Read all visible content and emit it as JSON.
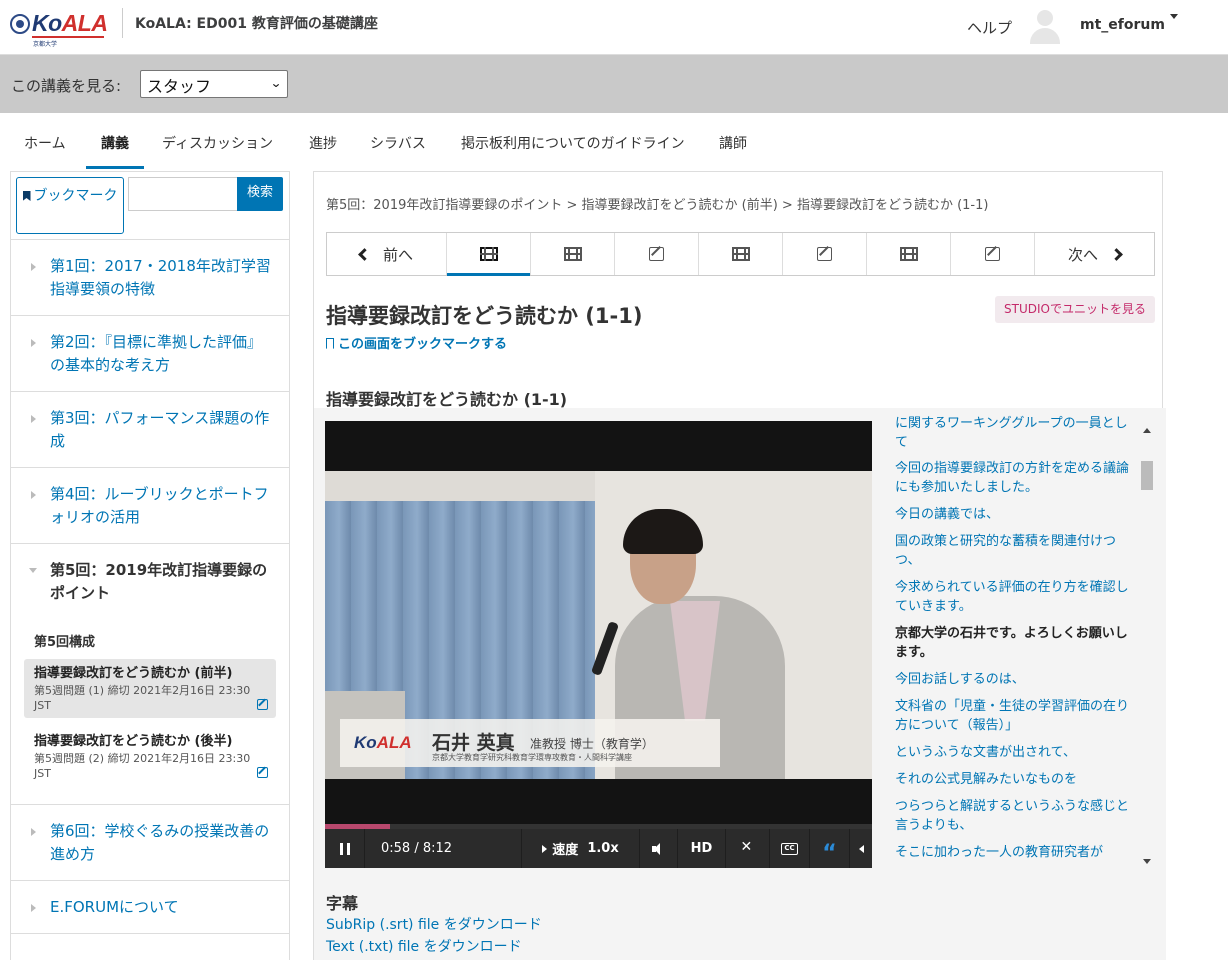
{
  "header": {
    "logo_text_ko": "Ko",
    "logo_text_ala": "ALA",
    "logo_sub": "京都大学",
    "course_title": "KoALA: ED001 教育評価の基礎講座",
    "help": "ヘルプ",
    "username": "mt_eforum"
  },
  "viewbar": {
    "label": "この講義を見る:",
    "selected": "スタッフ"
  },
  "tabs": [
    {
      "label": "ホーム"
    },
    {
      "label": "講義"
    },
    {
      "label": "ディスカッション"
    },
    {
      "label": "進捗"
    },
    {
      "label": "シラバス"
    },
    {
      "label": "掲示板利用についてのガイドライン"
    },
    {
      "label": "講師"
    }
  ],
  "sidebar": {
    "bookmark_button": "ブックマーク",
    "search_button": "検索",
    "sections": [
      {
        "label": "第1回：2017・2018年改訂学習指導要領の特徴"
      },
      {
        "label": "第2回：『目標に準拠した評価』の基本的な考え方"
      },
      {
        "label": "第3回：パフォーマンス課題の作成"
      },
      {
        "label": "第4回：ルーブリックとポートフォリオの活用"
      },
      {
        "label": "第5回：2019年改訂指導要録のポイント"
      },
      {
        "label": "第6回：学校ぐるみの授業改善の進め方"
      },
      {
        "label": "E.FORUMについて"
      }
    ],
    "composition_label": "第5回構成",
    "subsections": [
      {
        "title": "指導要録改訂をどう読むか (前半)",
        "due": "第5週問題 (1) 締切 2021年2月16日 23:30 JST"
      },
      {
        "title": "指導要録改訂をどう読むか (後半)",
        "due": "第5週問題 (2) 締切 2021年2月16日 23:30 JST"
      }
    ]
  },
  "main": {
    "breadcrumb": "第5回：2019年改訂指導要録のポイント > 指導要録改訂をどう読むか (前半) > 指導要録改訂をどう読むか (1-1)",
    "prev": "前へ",
    "next": "次へ",
    "unit_title": "指導要録改訂をどう読むか (1-1)",
    "studio_button": "STUDIOでユニットを見る",
    "bookmark_link": "この画面をブックマークする",
    "video_heading": "指導要録改訂をどう読むか (1-1)",
    "captions_title": "字幕",
    "download_srt": "SubRip (.srt) file をダウンロード",
    "download_txt": "Text (.txt) file をダウンロード"
  },
  "video": {
    "time": "0:58 / 8:12",
    "speed_label": "速度",
    "speed_value": "1.0x",
    "hd": "HD",
    "cc": "CC",
    "progress": 0.118,
    "overlay_logo_ko": "Ko",
    "overlay_logo_ala": "ALA",
    "overlay_name": "石井 英真",
    "overlay_title": "准教授 博士（教育学）",
    "overlay_affiliation": "京都大学教育学研究科教育学環専攻教育・人間科学講座"
  },
  "transcript": [
    {
      "text": "に関するワーキンググループの一員として"
    },
    {
      "text": "今回の指導要録改訂の方針を定める議論にも参加いたしました。"
    },
    {
      "text": "今日の講義では、"
    },
    {
      "text": "国の政策と研究的な蓄積を関連付けつつ、"
    },
    {
      "text": "今求められている評価の在り方を確認していきます。"
    },
    {
      "text": "京都大学の石井です。よろしくお願いします。"
    },
    {
      "text": "今回お話しするのは、"
    },
    {
      "text": "文科省の「児童・生徒の学習評価の在り方について（報告）」"
    },
    {
      "text": "というふうな文書が出されて、"
    },
    {
      "text": "それの公式見解みたいなものを"
    },
    {
      "text": "つらつらと解説するというふうな感じと言うよりも、"
    },
    {
      "text": "そこに加わった一人の教育研究者が"
    }
  ]
}
